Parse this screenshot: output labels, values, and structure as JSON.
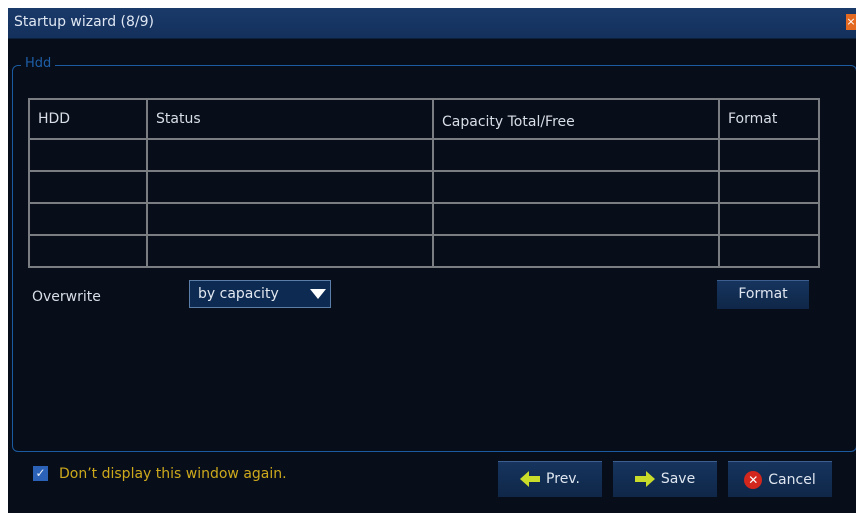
{
  "window": {
    "title": "Startup wizard (8/9)",
    "close_glyph": "×"
  },
  "group": {
    "legend": "Hdd"
  },
  "table": {
    "headers": [
      "HDD",
      "Status",
      "Capacity Total/Free",
      "Format"
    ],
    "rows": [
      [
        "",
        "",
        "",
        ""
      ],
      [
        "",
        "",
        "",
        ""
      ],
      [
        "",
        "",
        "",
        ""
      ],
      [
        "",
        "",
        "",
        ""
      ]
    ]
  },
  "overwrite": {
    "label": "Overwrite",
    "selected": "by capacity"
  },
  "buttons": {
    "format": "Format",
    "prev": "Prev.",
    "save": "Save",
    "cancel": "Cancel"
  },
  "dont_display": {
    "checked": true,
    "label": "Don’t display this window again."
  },
  "colors": {
    "background": "#070d19",
    "titlebar": "#14305c",
    "accent_border": "#1c5aa0",
    "checkbox_label": "#cda91c",
    "arrow": "#c9dc2a",
    "cancel": "#d3261d"
  },
  "icons": {
    "close": "close-icon",
    "dropdown": "chevron-down-icon",
    "prev": "arrow-left-icon",
    "save": "arrow-right-icon",
    "cancel": "cancel-x-icon",
    "checkbox": "checkmark-icon"
  }
}
